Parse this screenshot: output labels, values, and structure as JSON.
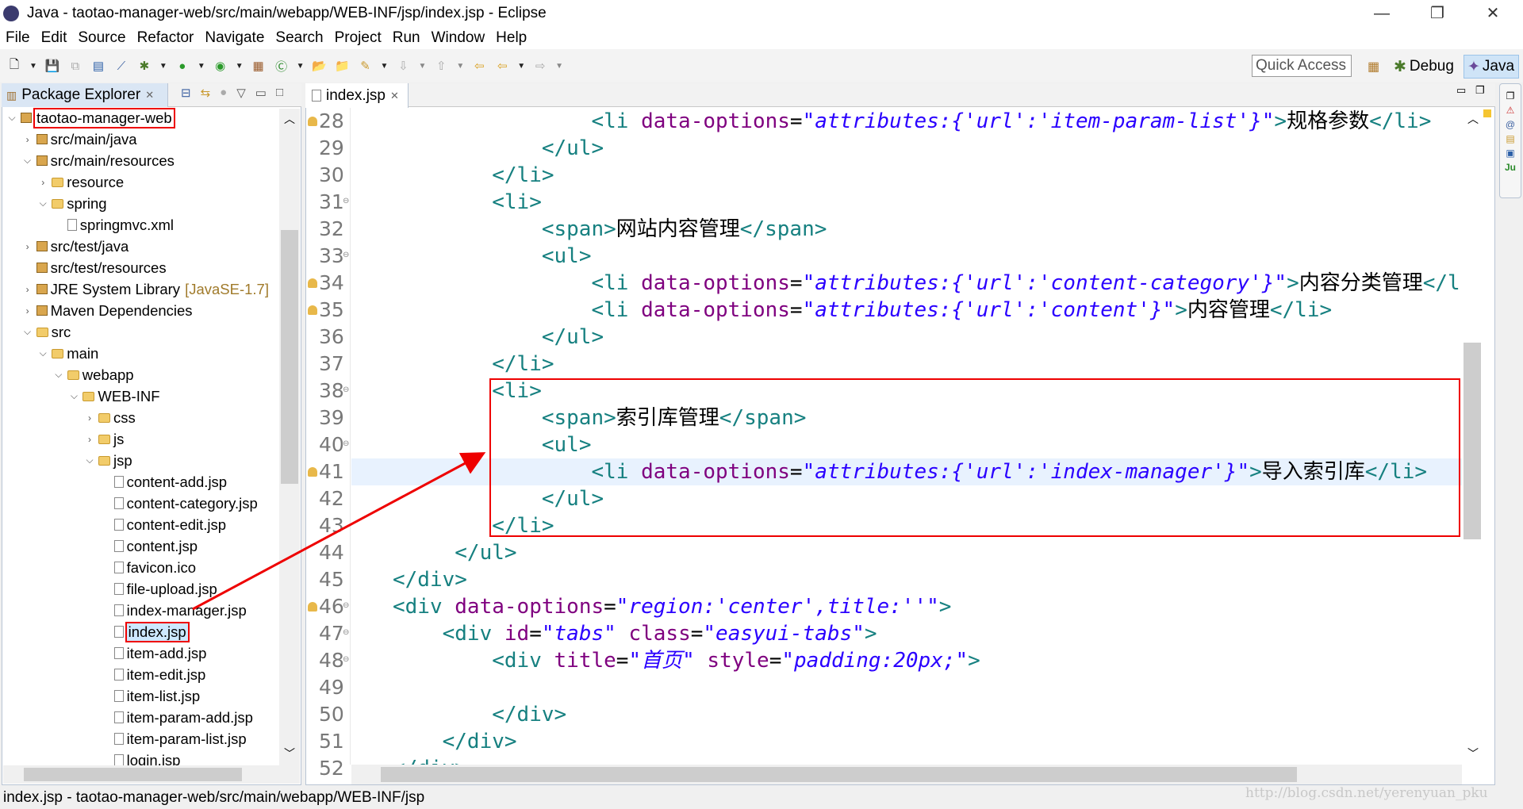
{
  "window": {
    "title": "Java - taotao-manager-web/src/main/webapp/WEB-INF/jsp/index.jsp - Eclipse",
    "minimize": "—",
    "restore": "❐",
    "close": "✕"
  },
  "menu": [
    "File",
    "Edit",
    "Source",
    "Refactor",
    "Navigate",
    "Search",
    "Project",
    "Run",
    "Window",
    "Help"
  ],
  "toolbar": {
    "quick_access": "Quick Access",
    "perspectives": {
      "debug": "Debug",
      "java": "Java"
    }
  },
  "package_explorer": {
    "tab_label": "Package Explorer",
    "tree": [
      {
        "label": "taotao-manager-web",
        "level": 0,
        "state": "expanded",
        "icon": "project-icon",
        "highlight": true
      },
      {
        "label": "src/main/java",
        "level": 1,
        "state": "collapsed",
        "icon": "source-folder-icon"
      },
      {
        "label": "src/main/resources",
        "level": 1,
        "state": "expanded",
        "icon": "source-folder-icon"
      },
      {
        "label": "resource",
        "level": 2,
        "state": "collapsed",
        "icon": "folder-icon"
      },
      {
        "label": "spring",
        "level": 2,
        "state": "expanded",
        "icon": "folder-icon"
      },
      {
        "label": "springmvc.xml",
        "level": 3,
        "state": "leaf",
        "icon": "xml-file-icon"
      },
      {
        "label": "src/test/java",
        "level": 1,
        "state": "collapsed",
        "icon": "source-folder-icon"
      },
      {
        "label": "src/test/resources",
        "level": 1,
        "state": "leaf",
        "icon": "source-folder-icon"
      },
      {
        "label": "JRE System Library",
        "decoration": "[JavaSE-1.7]",
        "level": 1,
        "state": "collapsed",
        "icon": "library-icon"
      },
      {
        "label": "Maven Dependencies",
        "level": 1,
        "state": "collapsed",
        "icon": "library-icon"
      },
      {
        "label": "src",
        "level": 1,
        "state": "expanded",
        "icon": "folder-icon"
      },
      {
        "label": "main",
        "level": 2,
        "state": "expanded",
        "icon": "folder-icon"
      },
      {
        "label": "webapp",
        "level": 3,
        "state": "expanded",
        "icon": "folder-icon"
      },
      {
        "label": "WEB-INF",
        "level": 4,
        "state": "expanded",
        "icon": "folder-icon"
      },
      {
        "label": "css",
        "level": 5,
        "state": "collapsed",
        "icon": "folder-icon"
      },
      {
        "label": "js",
        "level": 5,
        "state": "collapsed",
        "icon": "folder-icon"
      },
      {
        "label": "jsp",
        "level": 5,
        "state": "expanded",
        "icon": "folder-icon"
      },
      {
        "label": "content-add.jsp",
        "level": 6,
        "state": "leaf",
        "icon": "jsp-file-icon"
      },
      {
        "label": "content-category.jsp",
        "level": 6,
        "state": "leaf",
        "icon": "jsp-file-icon"
      },
      {
        "label": "content-edit.jsp",
        "level": 6,
        "state": "leaf",
        "icon": "jsp-file-icon"
      },
      {
        "label": "content.jsp",
        "level": 6,
        "state": "leaf",
        "icon": "jsp-file-icon"
      },
      {
        "label": "favicon.ico",
        "level": 6,
        "state": "leaf",
        "icon": "file-icon"
      },
      {
        "label": "file-upload.jsp",
        "level": 6,
        "state": "leaf",
        "icon": "jsp-file-icon"
      },
      {
        "label": "index-manager.jsp",
        "level": 6,
        "state": "leaf",
        "icon": "jsp-file-icon"
      },
      {
        "label": "index.jsp",
        "level": 6,
        "state": "leaf",
        "icon": "jsp-file-icon",
        "selected": true,
        "highlight": true
      },
      {
        "label": "item-add.jsp",
        "level": 6,
        "state": "leaf",
        "icon": "jsp-file-icon"
      },
      {
        "label": "item-edit.jsp",
        "level": 6,
        "state": "leaf",
        "icon": "jsp-file-icon"
      },
      {
        "label": "item-list.jsp",
        "level": 6,
        "state": "leaf",
        "icon": "jsp-file-icon"
      },
      {
        "label": "item-param-add.jsp",
        "level": 6,
        "state": "leaf",
        "icon": "jsp-file-icon"
      },
      {
        "label": "item-param-list.jsp",
        "level": 6,
        "state": "leaf",
        "icon": "jsp-file-icon"
      },
      {
        "label": "login.jsp",
        "level": 6,
        "state": "leaf",
        "icon": "jsp-file-icon"
      }
    ]
  },
  "editor": {
    "tab_label": "index.jsp",
    "current_line": 41,
    "lines": [
      {
        "n": "28",
        "warn": true,
        "text": "                <li data-options=\"attributes:{'url':'item-param-list'}\">规格参数</li>"
      },
      {
        "n": "29",
        "text": "            </ul>"
      },
      {
        "n": "30",
        "text": "        </li>"
      },
      {
        "n": "31",
        "fold": true,
        "text": "        <li>"
      },
      {
        "n": "32",
        "text": "            <span>网站内容管理</span>"
      },
      {
        "n": "33",
        "fold": true,
        "text": "            <ul>"
      },
      {
        "n": "34",
        "warn": true,
        "text": "                <li data-options=\"attributes:{'url':'content-category'}\">内容分类管理</li>"
      },
      {
        "n": "35",
        "warn": true,
        "text": "                <li data-options=\"attributes:{'url':'content'}\">内容管理</li>"
      },
      {
        "n": "36",
        "text": "            </ul>"
      },
      {
        "n": "37",
        "text": "        </li>"
      },
      {
        "n": "38",
        "fold": true,
        "text": "        <li>"
      },
      {
        "n": "39",
        "text": "            <span>索引库管理</span>"
      },
      {
        "n": "40",
        "fold": true,
        "text": "            <ul>"
      },
      {
        "n": "41",
        "warn": true,
        "text": "                <li data-options=\"attributes:{'url':'index-manager'}\">导入索引库</li>"
      },
      {
        "n": "42",
        "text": "            </ul>"
      },
      {
        "n": "43",
        "text": "        </li>"
      },
      {
        "n": "44",
        "text": "     </ul>"
      },
      {
        "n": "45",
        "text": "</div>"
      },
      {
        "n": "46",
        "warn": true,
        "fold": true,
        "text": "<div data-options=\"region:'center',title:''\">"
      },
      {
        "n": "47",
        "fold": true,
        "text": "    <div id=\"tabs\" class=\"easyui-tabs\">"
      },
      {
        "n": "48",
        "fold": true,
        "text": "        <div title=\"首页\" style=\"padding:20px;\">"
      },
      {
        "n": "49",
        "text": ""
      },
      {
        "n": "50",
        "text": "        </div>"
      },
      {
        "n": "51",
        "text": "    </div>"
      },
      {
        "n": "52",
        "text": "</div>"
      }
    ]
  },
  "status_bar": {
    "text": "index.jsp - taotao-manager-web/src/main/webapp/WEB-INF/jsp"
  },
  "watermark": "http://blog.csdn.net/yerenyuan_pku",
  "colors": {
    "tag": "#168080",
    "attribute": "#7f007f",
    "string": "#2a00ff",
    "annotation": "#e00000",
    "current_line": "#e8f2fe"
  }
}
